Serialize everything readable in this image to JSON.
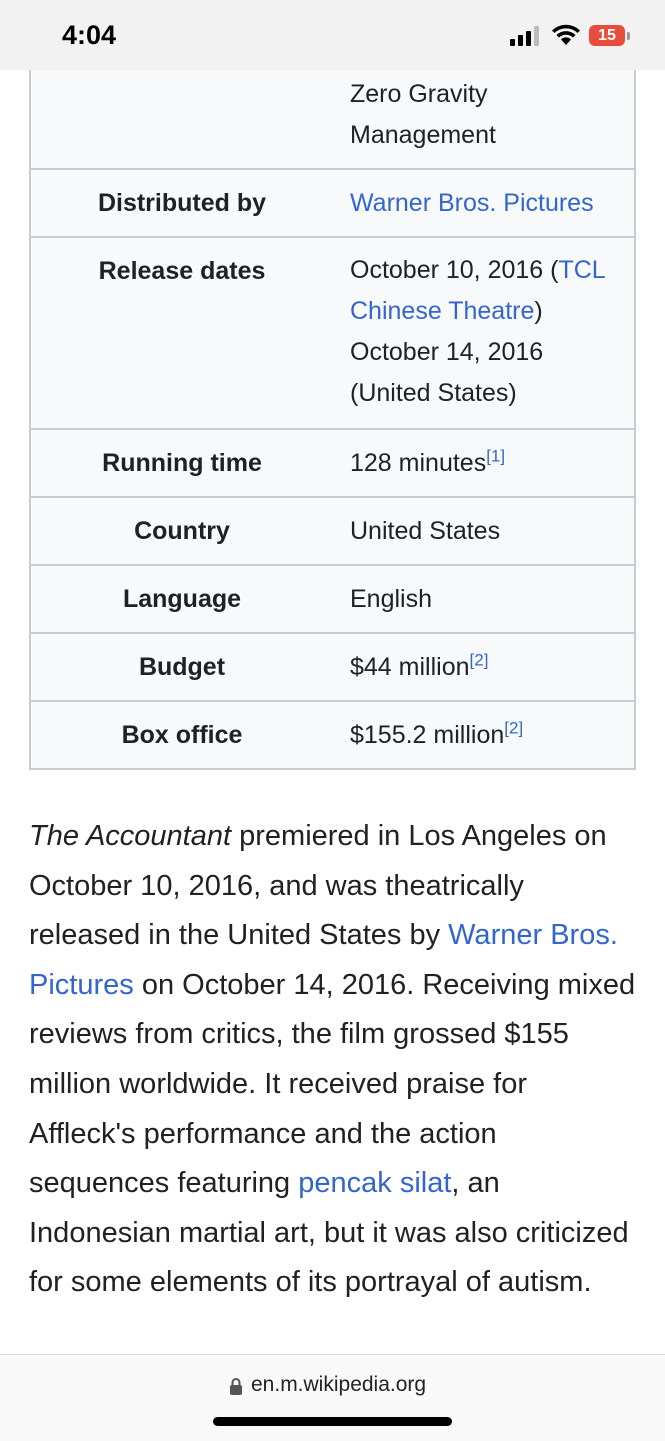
{
  "status_bar": {
    "time": "4:04",
    "battery": "15"
  },
  "infobox": {
    "production_continued": [
      "Zero Gravity",
      "Management"
    ],
    "rows": [
      {
        "label": "Distributed by",
        "value_link": "Warner Bros. Pictures"
      },
      {
        "label": "Release dates",
        "line1_text": "October 10, 2016 (",
        "line1_link": "TCL",
        "line2_link": "Chinese Theatre",
        "line2_text": ")",
        "line3": "October 14, 2016",
        "line4": "(United States)"
      },
      {
        "label": "Running time",
        "value": "128 minutes",
        "ref": "[1]"
      },
      {
        "label": "Country",
        "value": "United States"
      },
      {
        "label": "Language",
        "value": "English"
      },
      {
        "label": "Budget",
        "value": "$44 million",
        "ref": "[2]"
      },
      {
        "label": "Box office",
        "value": "$155.2 million",
        "ref": "[2]"
      }
    ]
  },
  "paragraph": {
    "title_italic": "The Accountant",
    "part1": " premiered in Los Angeles on October 10, 2016, and was theatrically released in the United States by ",
    "link1": "Warner Bros. Pictures",
    "part2": " on October 14, 2016. Receiving mixed reviews from critics, the film grossed $155 million worldwide. It received praise for Affleck's performance and the action sequences featuring ",
    "link2": "pencak silat",
    "part3": ", an Indonesian martial art, but it was also criticized for some elements of its portrayal of autism."
  },
  "browser": {
    "url": "en.m.wikipedia.org"
  }
}
